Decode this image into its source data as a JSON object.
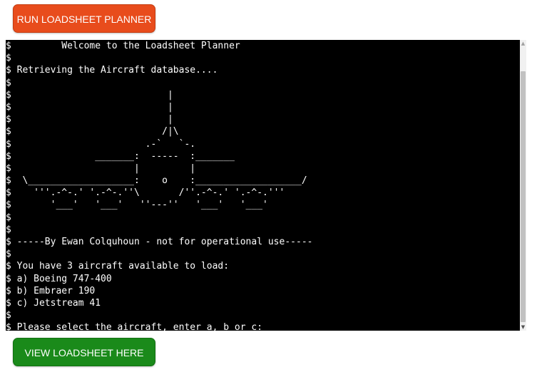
{
  "buttons": {
    "run_label": "RUN LOADSHEET PLANNER",
    "view_label": "VIEW LOADSHEET HERE"
  },
  "colors": {
    "run_button": "#e84c1c",
    "view_button": "#1a8a1a",
    "terminal_bg": "#000000",
    "terminal_fg": "#ffffff"
  },
  "terminal": {
    "lines": [
      "$         Welcome to the Loadsheet Planner",
      "$",
      "$ Retrieving the Aircraft database....",
      "$",
      "$                            |",
      "$                            |",
      "$                            |",
      "$                           /|\\",
      "$                        .-`   `-.",
      "$               _______:  -----  :_______",
      "$                      |         |",
      "$  \\___________________:    o    :___________________/",
      "$    '''.-^-.' '.-^-.''\\       /''.-^-.' '.-^-.'''",
      "$       '___'   '___'   ''---''   '___'   '___'",
      "$",
      "$",
      "$ -----By Ewan Colquhoun - not for operational use-----",
      "$",
      "$ You have 3 aircraft available to load:",
      "$ a) Boeing 747-400",
      "$ b) Embraer 190",
      "$ c) Jetstream 41",
      "$",
      "$ Please select the aircraft, enter a, b or c:",
      "$"
    ]
  },
  "scrollbar": {
    "up_icon": "triangle-up",
    "down_icon": "triangle-down"
  }
}
